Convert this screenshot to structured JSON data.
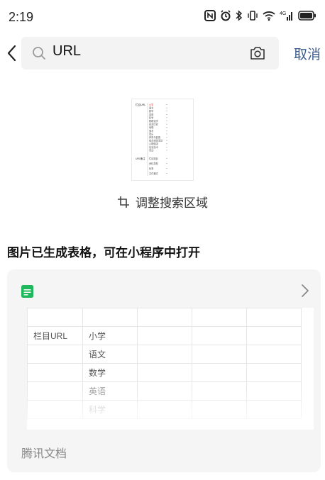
{
  "status": {
    "time": "2:19"
  },
  "search": {
    "query": "URL",
    "cancel_label": "取消"
  },
  "adjust": {
    "label": "调整搜索区域"
  },
  "section": {
    "title": "图片已生成表格，可在小程序中打开"
  },
  "card": {
    "source_label": "腾讯文档",
    "table": {
      "rows": [
        [
          "",
          "",
          "",
          "",
          ""
        ],
        [
          "栏目URL",
          "小学",
          "",
          "",
          ""
        ],
        [
          "",
          "语文",
          "",
          "",
          ""
        ],
        [
          "",
          "数学",
          "",
          "",
          ""
        ],
        [
          "",
          "英语",
          "",
          "",
          ""
        ],
        [
          "",
          "科学",
          "",
          "",
          ""
        ]
      ]
    }
  },
  "thumbnail": {
    "header_label": "栏目URL",
    "items": [
      "小学",
      "语文",
      "数学",
      "英语",
      "科学",
      "物理化学",
      "政治历史",
      "地理",
      "美术",
      "音乐",
      "体育与健康",
      "综合实践活动",
      "心理健康",
      "信息技术",
      "劳动"
    ],
    "footer_label": "URL备注",
    "footer_items": [
      "栏目题目",
      "资料类型",
      "标签",
      "文件格式"
    ]
  },
  "colors": {
    "accent": "#3a5b8c",
    "doc_green": "#1fb85c",
    "card_bg": "#f5f5f5",
    "search_bg": "#f3f3f3"
  }
}
